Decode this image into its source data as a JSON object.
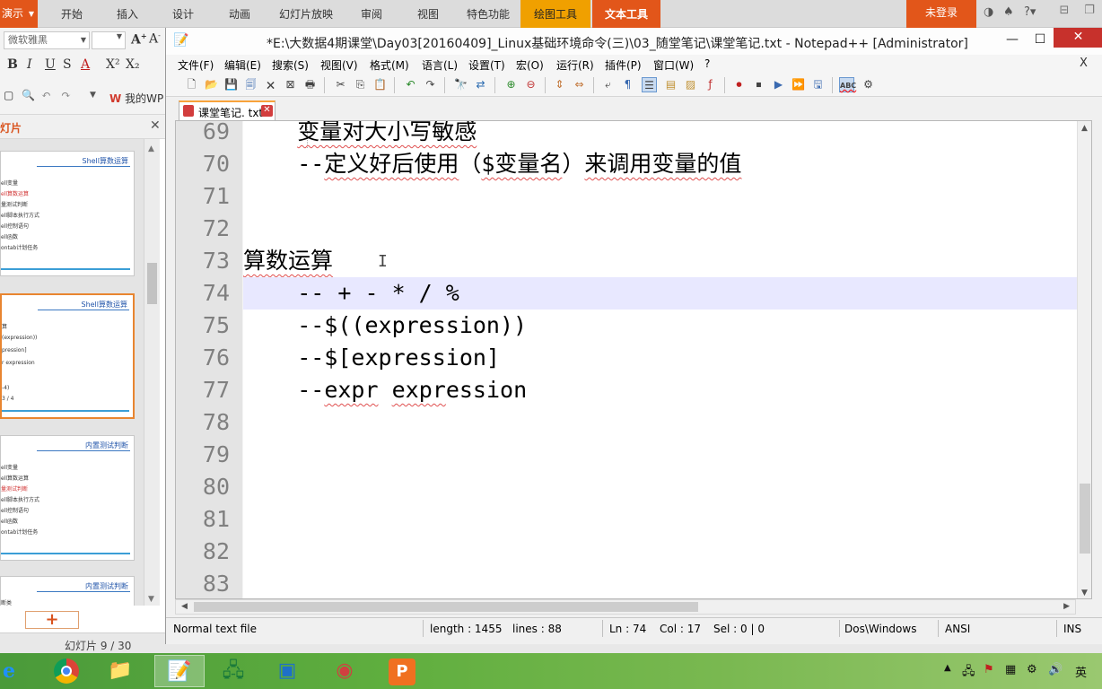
{
  "wps": {
    "app_button": "演示",
    "ribbon_tabs": [
      "开始",
      "插入",
      "设计",
      "动画",
      "幻灯片放映",
      "审阅",
      "视图",
      "特色功能",
      "绘图工具",
      "文本工具"
    ],
    "login": "未登录",
    "help": "?",
    "font_name": "微软雅黑",
    "font_size": "",
    "format_buttons": [
      "B",
      "I",
      "U",
      "S",
      "A",
      "X²",
      "X₂"
    ],
    "my_wps": "我的WP",
    "pane_title": "灯片",
    "slides": [
      {
        "title": "Shell算数运算",
        "items": [
          "ell变量",
          "ell算数运算",
          "量测试判断",
          "ell脚本执行方式",
          "ell控制语句",
          "ell函数",
          "ontab计划任务"
        ]
      },
      {
        "title": "Shell算数运算",
        "items": [
          "算",
          "(expression))",
          "pression]",
          "r expression",
          "-4)",
          "3 / 4"
        ]
      },
      {
        "title": "内置测试判断",
        "items": [
          "ell变量",
          "ell算数运算",
          "量测试判断",
          "ell脚本执行方式",
          "ell控制语句",
          "ell函数",
          "ontab计划任务"
        ]
      },
      {
        "title": "内置测试判断",
        "items": [
          "断类"
        ]
      }
    ],
    "slide_count": "幻灯片 9 / 30",
    "add_slide": "+"
  },
  "npp": {
    "title": "*E:\\大数据4期课堂\\Day03[20160409]_Linux基础环境命令(三)\\03_随堂笔记\\课堂笔记.txt - Notepad++ [Administrator]",
    "menu": [
      "文件(F)",
      "编辑(E)",
      "搜索(S)",
      "视图(V)",
      "格式(M)",
      "语言(L)",
      "设置(T)",
      "宏(O)",
      "运行(R)",
      "插件(P)",
      "窗口(W)",
      "?"
    ],
    "menu_close": "X",
    "tab_label": "课堂笔记. txt",
    "lines": [
      {
        "num": "69",
        "text": "    变量对大小写敏感"
      },
      {
        "num": "70",
        "text": "    --定义好后使用（$变量名）来调用变量的值"
      },
      {
        "num": "71",
        "text": ""
      },
      {
        "num": "72",
        "text": ""
      },
      {
        "num": "73",
        "text": "算数运算"
      },
      {
        "num": "74",
        "text": "    -- + - * / %"
      },
      {
        "num": "75",
        "text": "    --$((expression))"
      },
      {
        "num": "76",
        "text": "    --$[expression]"
      },
      {
        "num": "77",
        "text": "    --expr expression"
      },
      {
        "num": "78",
        "text": ""
      },
      {
        "num": "79",
        "text": ""
      },
      {
        "num": "80",
        "text": ""
      },
      {
        "num": "81",
        "text": ""
      },
      {
        "num": "82",
        "text": ""
      },
      {
        "num": "83",
        "text": ""
      }
    ],
    "caret_line": "74",
    "status": {
      "file_type": "Normal text file",
      "length": "length : 1455",
      "lines": "lines : 88",
      "ln": "Ln : 74",
      "col": "Col : 17",
      "sel": "Sel : 0 | 0",
      "eol": "Dos\\Windows",
      "encoding": "ANSI",
      "mode": "INS"
    }
  },
  "taskbar": {
    "ime": "英"
  },
  "colors": {
    "wps_accent": "#e2561a",
    "npp_current_line": "#e8e8ff",
    "taskbar_green": "#5fae3e"
  }
}
